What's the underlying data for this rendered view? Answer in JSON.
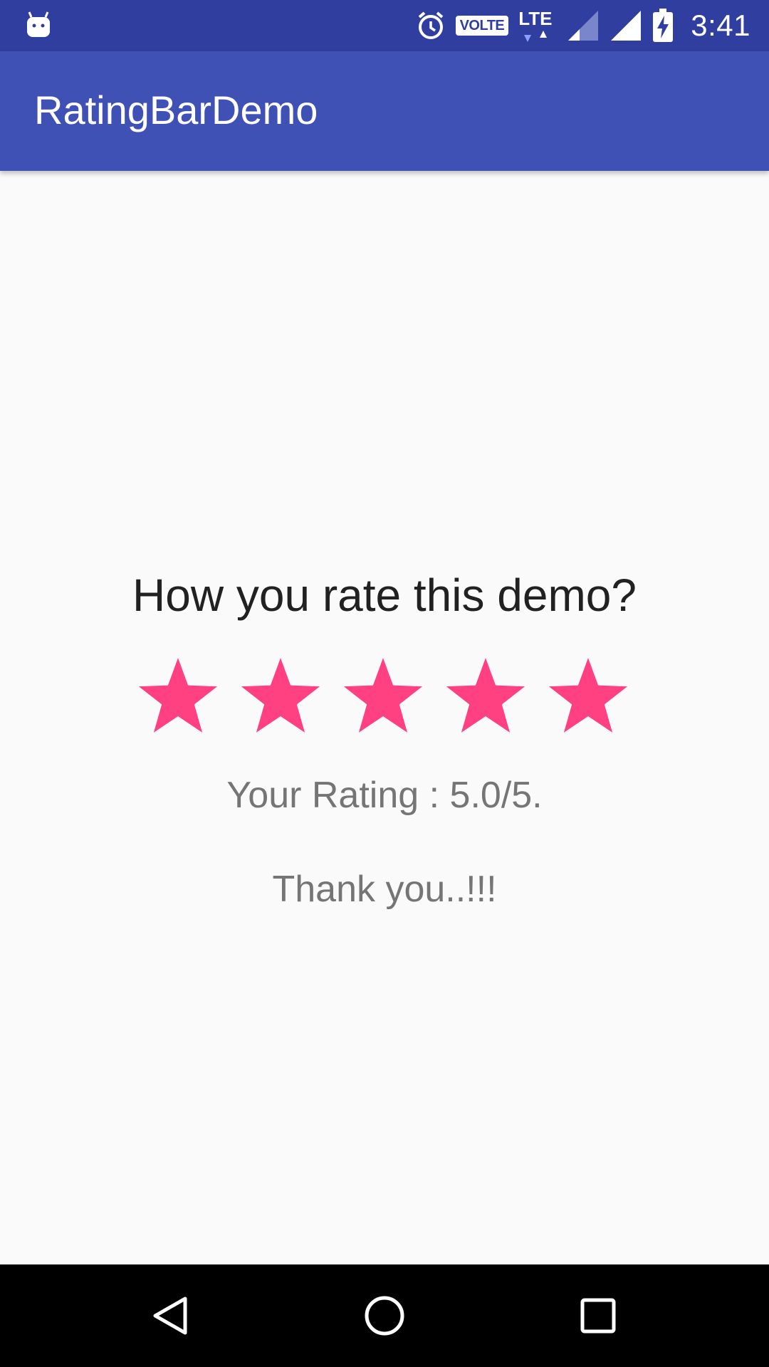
{
  "status_bar": {
    "time": "3:41",
    "volte_label": "VOLTE",
    "network_label": "LTE",
    "icons": [
      "android-icon",
      "alarm-icon",
      "volte-icon",
      "lte-data-icon",
      "signal-icon",
      "signal-full-icon",
      "battery-charging-icon"
    ]
  },
  "app_bar": {
    "title": "RatingBarDemo",
    "color": "#3f51b5"
  },
  "content": {
    "question": "How you rate this demo?",
    "rating": {
      "value": 5.0,
      "max": 5,
      "star_color": "#ff4081"
    },
    "rating_result": "Your Rating : 5.0/5.",
    "thanks": "Thank you..!!!"
  },
  "nav_bar": {
    "buttons": [
      "back-icon",
      "home-icon",
      "recents-icon"
    ]
  }
}
